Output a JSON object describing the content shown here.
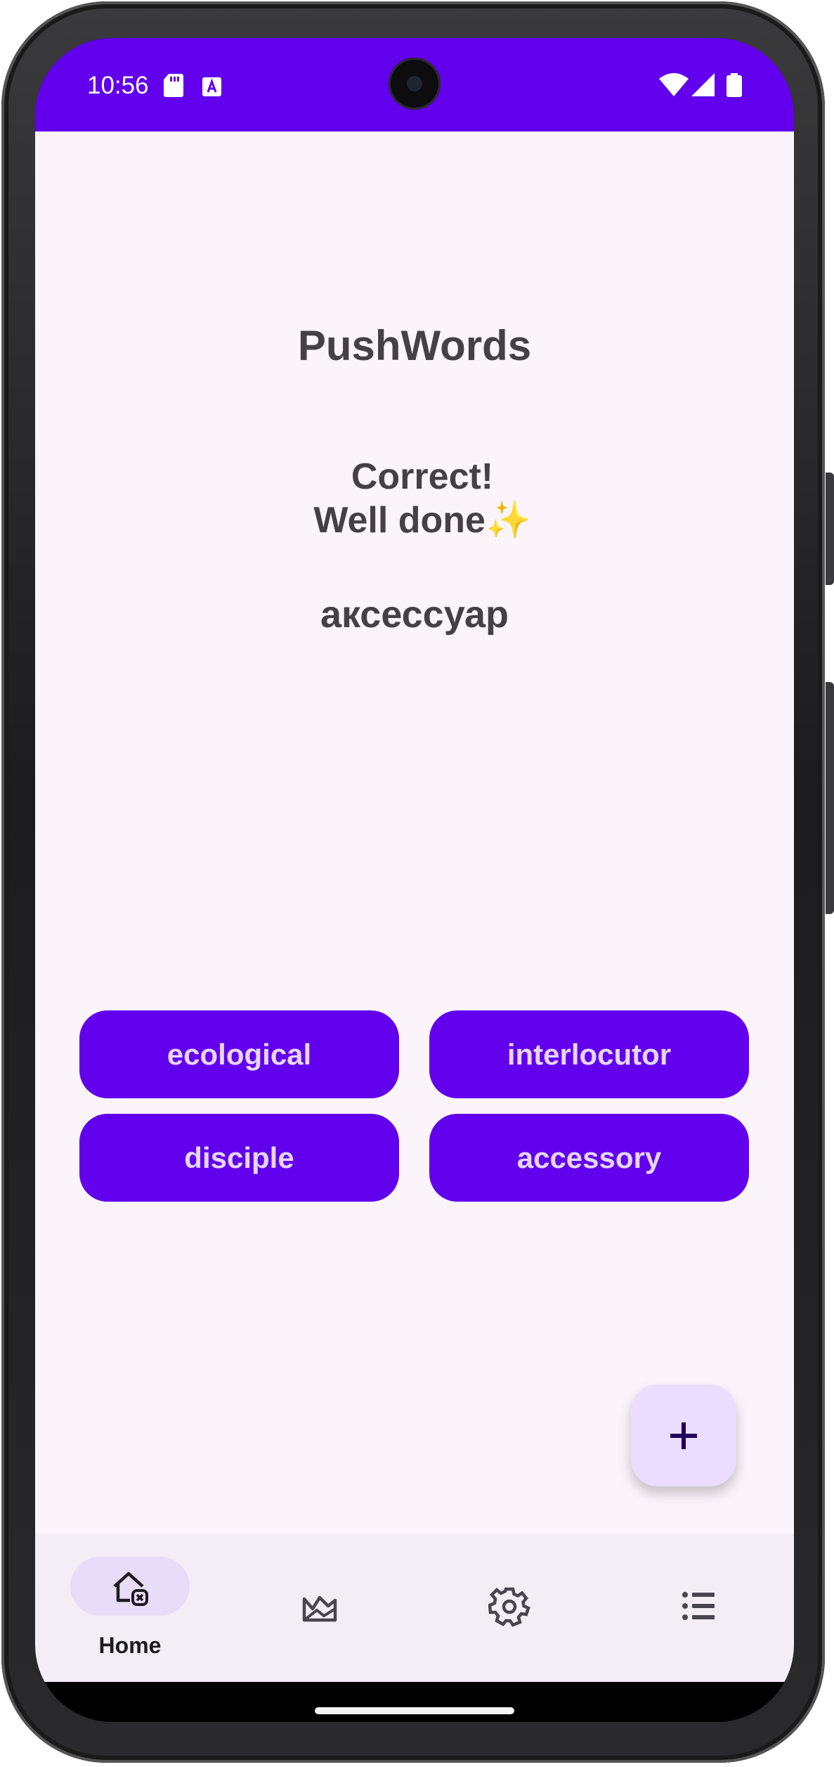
{
  "status_bar": {
    "time": "10:56",
    "icons": [
      "sd-card-icon",
      "font-a-icon",
      "wifi-icon",
      "signal-icon",
      "battery-icon"
    ]
  },
  "app": {
    "title": "PushWords"
  },
  "quiz": {
    "feedback_line1": "Correct!",
    "feedback_line2": "Well done",
    "feedback_emoji": "✨",
    "word": "аксессуар",
    "options": [
      "ecological",
      "interlocutor",
      "disciple",
      "accessory"
    ]
  },
  "fab": {
    "icon": "plus-icon",
    "label": "+"
  },
  "nav": {
    "items": [
      {
        "icon": "home-icon",
        "label": "Home",
        "selected": true
      },
      {
        "icon": "landscape-icon",
        "label": "",
        "selected": false
      },
      {
        "icon": "gear-icon",
        "label": "",
        "selected": false
      },
      {
        "icon": "list-icon",
        "label": "",
        "selected": false
      }
    ]
  },
  "colors": {
    "primary": "#6200ee",
    "background": "#fcf4fb",
    "on_primary_text": "#e5d6ff",
    "title_text": "#454045",
    "fab": "#eaddff",
    "nav_bg": "#f3edf6",
    "nav_pill": "#e8ddf8"
  }
}
